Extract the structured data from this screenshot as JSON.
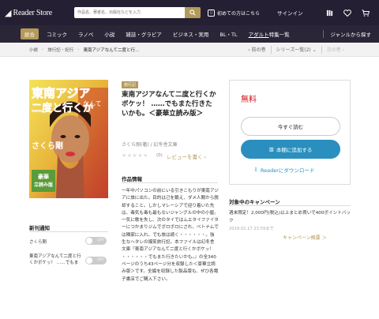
{
  "header": {
    "brand": "Reader Store",
    "search_placeholder": "作品名、著者名、出版社などを入力",
    "guide": "初めての方はこちら",
    "signin": "サインイン",
    "icons": [
      "bookshelf-icon",
      "heart-icon",
      "cart-icon"
    ]
  },
  "nav": {
    "items": [
      "総合",
      "コミック",
      "ラノベ",
      "小説",
      "雑誌・グラビア",
      "ビジネス・実用",
      "BL・TL"
    ],
    "adult": "アダルト",
    "special": "特集一覧",
    "genre": "ジャンルから探す"
  },
  "breadcrumb": {
    "items": [
      "小説",
      "旅行記・紀行",
      "東南アジアなんて二度と行…"
    ],
    "prev": "前の巻",
    "series": "シリーズ一覧(2)",
    "next": "次の巻"
  },
  "cover": {
    "title_line1": "東南アジア",
    "title_line2": "なんて",
    "title_line3": "二度と行くか",
    "author": "さくら剛",
    "badge_line1": "豪華",
    "badge_line2": "立読み版"
  },
  "book": {
    "badge": "旅行記",
    "title": "東南アジアなんて二度と行くかボケッ！ ……でもまた行きたいかも。＜豪華立読み版＞",
    "author": "さくら剛(著) / 幻冬舎文庫",
    "stars": "★★★★★",
    "review_count": "(0)",
    "review_link": "レビューを書く",
    "info_heading": "作品情報",
    "description": "一年中パソコンの前にいる引きこもりが東南アジアに旅に出た。目的は己を鍛え、ダメ人間から脱却すること。しかしマレーシアで迎り着いた先は、毒気も毒も最もないジャングルの中の小屋。一気に歌を失し、次のタイではムエタイファイターにつかまりジムでボロボロにされ、ベトナムでは隣家に入れ、でも旅は続く・・・・・・。強生なヘタレの爆笑旅行記。本ファイルは幻冬舎文庫『東南アジアなんて二度と行くかボケッ！ ・・・・・・でもまた行きたいかも。』の全340ページのうち43ページ分を収録した＜豪華立読み版＞です。全編を収録した製品版も、ぜひ各電子書店でご購入下さい。",
    "rating": 0
  },
  "buy": {
    "price": "無料",
    "read_now": "今すぐ読む",
    "add_shelf": "本棚に追加する",
    "download": "Readerにダウンロード"
  },
  "sidebar": {
    "heading": "新刊通知",
    "notices": [
      {
        "label": "さくら剛",
        "state": "OFF"
      },
      {
        "label": "東南アジアなんて二度と行くかボケッ！ ……でもま",
        "state": "OFF"
      }
    ]
  },
  "campaign": {
    "heading": "対象中のキャンペーン",
    "text": "週末限定！2,000円(税込)以上まとめ買いで400ポイントバック",
    "date": "2019.02.17 23:59まで",
    "link": "キャンペーン概要 ＞"
  }
}
